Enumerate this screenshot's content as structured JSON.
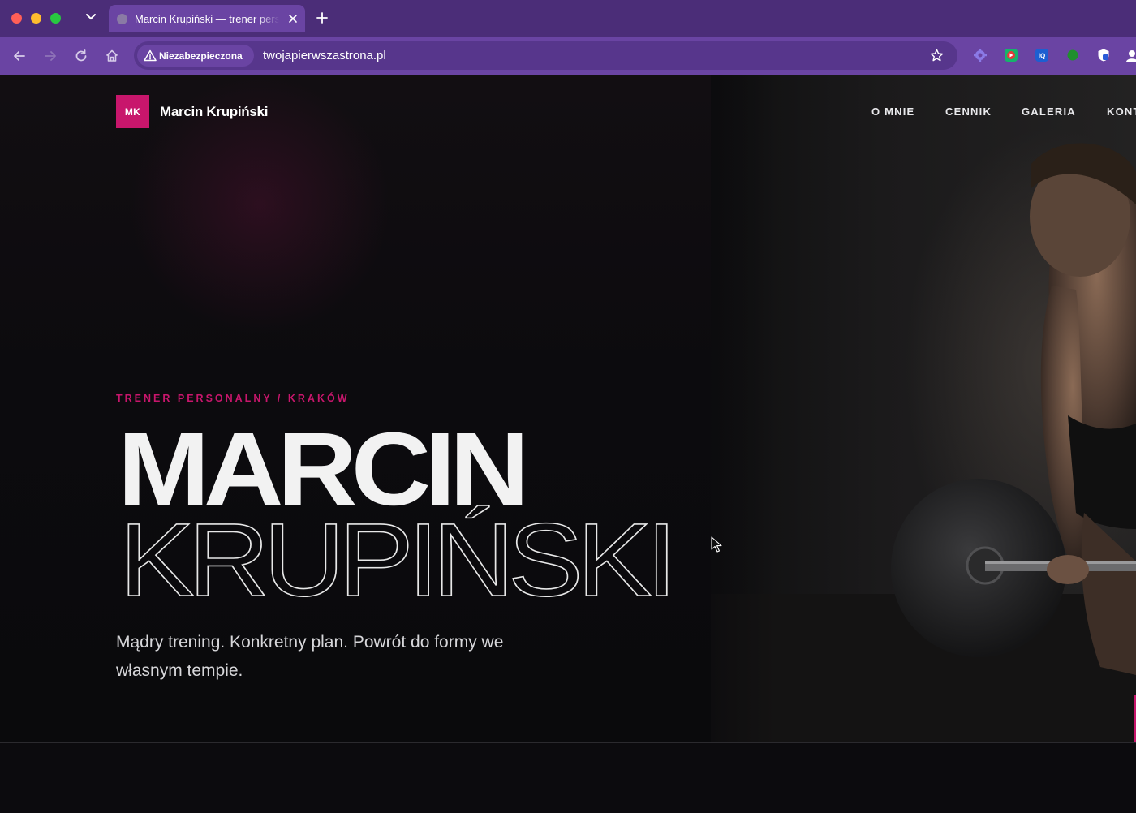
{
  "browser": {
    "tab_title": "Marcin Krupiński — trener personalny",
    "security_label": "Niezabezpieczona",
    "url": "twojapierwszastrona.pl",
    "extensions": [
      "puzzle-extension-icon",
      "screen-recorder-icon",
      "iq-extension-icon",
      "green-dot-extension-icon",
      "shield-extension-icon"
    ]
  },
  "site": {
    "logo_initials": "MK",
    "logo_name": "Marcin Krupiński",
    "nav": [
      "O MNIE",
      "CENNIK",
      "GALERIA",
      "KONTAKT"
    ],
    "colors": {
      "accent": "#c8166c",
      "background": "#0a090c",
      "chrome": "#6a44a3"
    }
  },
  "hero": {
    "eyebrow": "TRENER PERSONALNY / KRAKÓW",
    "title_line1": "MARCIN",
    "title_line2": "KRUPIŃSKI",
    "tagline": "Mądry trening. Konkretny plan. Powrót do formy we własnym tempie."
  }
}
